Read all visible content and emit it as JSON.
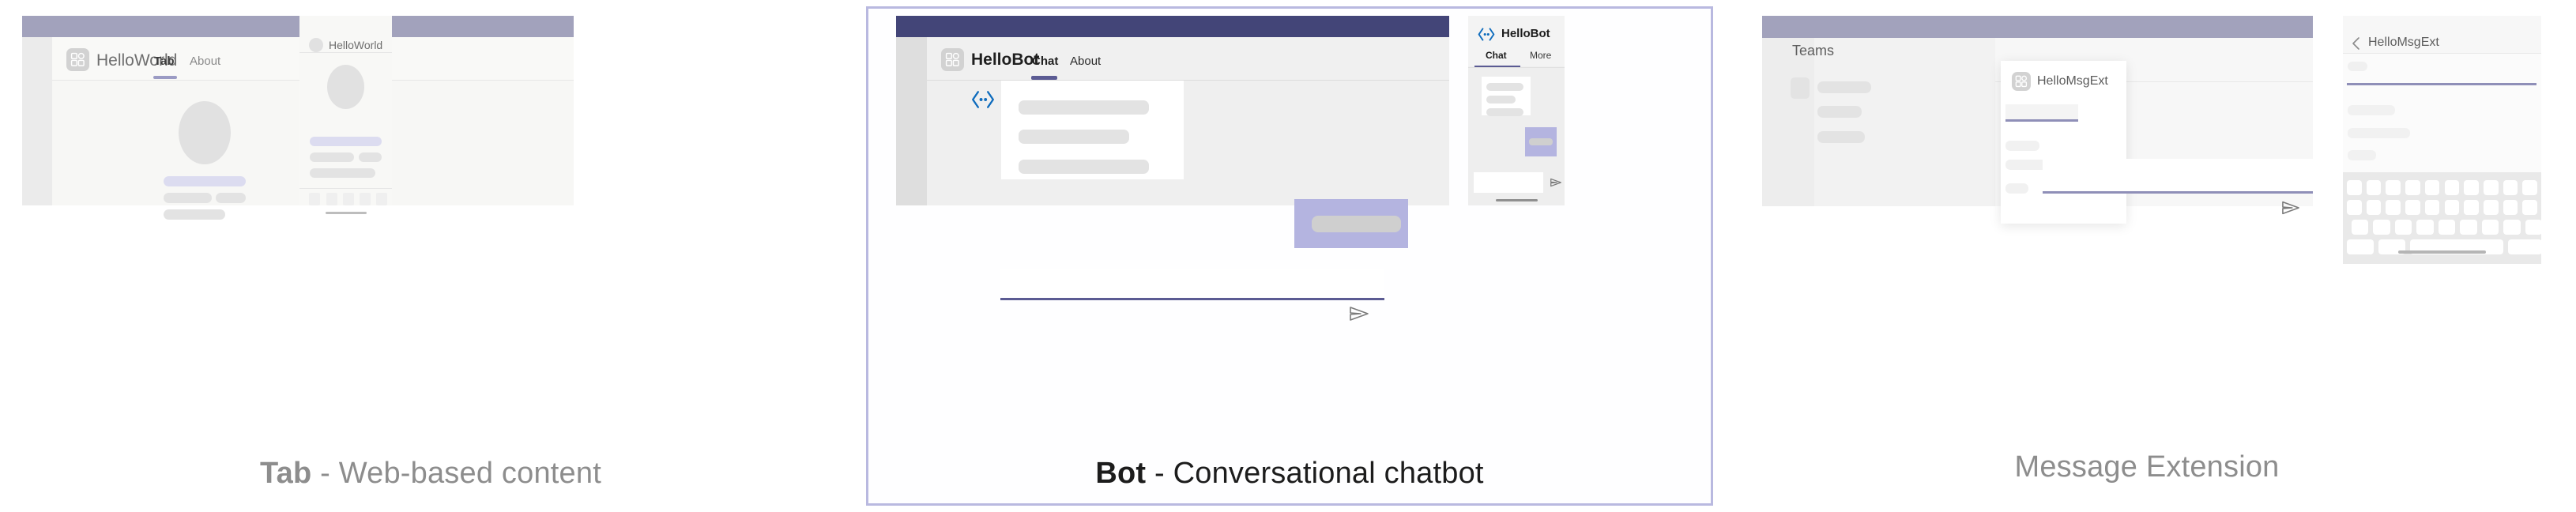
{
  "panels": [
    {
      "id": "tab",
      "caption_strong": "Tab",
      "caption_rest": " - Web-based content",
      "highlighted": false,
      "desktop": {
        "app_name": "HelloWorld",
        "app_icon": "teams-app-grid-icon",
        "tabs": [
          {
            "label": "Tab",
            "active": true
          },
          {
            "label": "About",
            "active": false
          }
        ]
      },
      "mobile": {
        "app_name": "HelloWorld",
        "avatar_icon": "circle-avatar-icon",
        "bottom_nav_item_count": 5
      },
      "colors": {
        "topbar": "#a2a2bc",
        "accent": "#9b9bc4",
        "skeleton": "#e3e3e3",
        "skeleton_accent": "#dcdcf0"
      }
    },
    {
      "id": "bot",
      "caption_strong": "Bot",
      "caption_rest": " - Conversational chatbot",
      "highlighted": true,
      "desktop": {
        "app_name": "HelloBot",
        "app_icon": "teams-app-grid-icon",
        "bot_avatar_icon": "bot-brackets-icon",
        "tabs": [
          {
            "label": "Chat",
            "active": true
          },
          {
            "label": "About",
            "active": false
          }
        ],
        "send_icon": "send-paperplane-icon",
        "message_card_lines": 3
      },
      "mobile": {
        "app_name": "HelloBot",
        "bot_icon": "bot-brackets-icon",
        "tabs": [
          {
            "label": "Chat",
            "active": true
          },
          {
            "label": "More",
            "active": false
          }
        ],
        "send_icon": "send-paperplane-icon",
        "message_card_lines": 3
      },
      "colors": {
        "topbar": "#434578",
        "accent": "#5b5b93",
        "bot_blue": "#0f6cbd",
        "bubble": "#b4b4e0",
        "skeleton": "#e3e3e3"
      }
    },
    {
      "id": "msgext",
      "caption_strong": "",
      "caption_rest": "Message Extension",
      "highlighted": false,
      "desktop": {
        "sidebar_title": "Teams",
        "popup_title": "HelloMsgExt",
        "popup_icon": "teams-app-grid-icon",
        "send_icon": "send-paperplane-icon",
        "sidebar_item_count": 3,
        "popup_result_count": 3
      },
      "mobile": {
        "title": "HelloMsgExt",
        "back_icon": "chevron-left-icon",
        "keyboard_rows": [
          10,
          10,
          9,
          4
        ],
        "field_count": 3
      },
      "colors": {
        "topbar": "#a2a2bc",
        "accent": "#8f8fb8",
        "skeleton": "#f1f1f1"
      }
    }
  ]
}
